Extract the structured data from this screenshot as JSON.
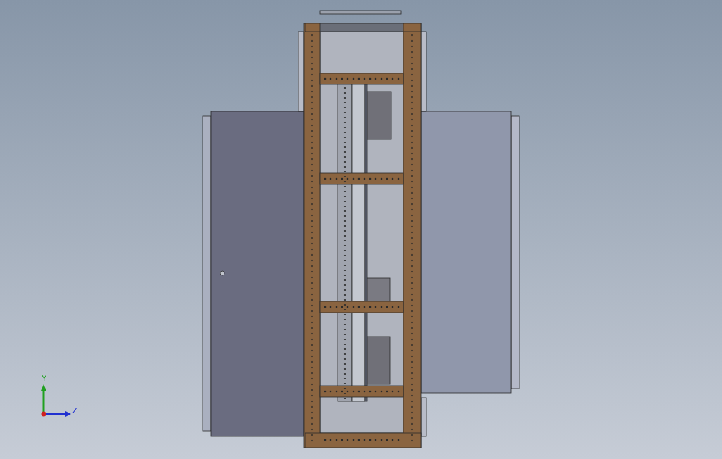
{
  "viewport": {
    "triad": {
      "axes": [
        {
          "label": "Y",
          "color": "#20a020"
        },
        {
          "label": "Z",
          "color": "#2030d0"
        }
      ]
    }
  }
}
